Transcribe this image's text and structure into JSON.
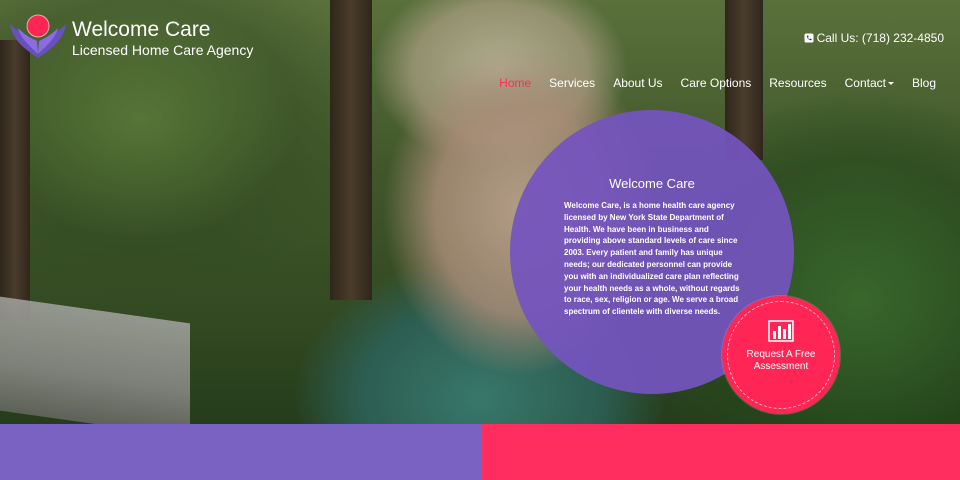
{
  "brand": {
    "title": "Welcome Care",
    "subtitle": "Licensed Home Care Agency"
  },
  "contact": {
    "phone_label": "Call Us: (718) 232-4850"
  },
  "nav": {
    "items": [
      {
        "label": "Home",
        "active": true
      },
      {
        "label": "Services"
      },
      {
        "label": "About Us"
      },
      {
        "label": "Care Options"
      },
      {
        "label": "Resources"
      },
      {
        "label": "Contact",
        "dropdown": true
      },
      {
        "label": "Blog"
      }
    ]
  },
  "info": {
    "title": "Welcome Care",
    "body": "Welcome Care, is a home health care agency licensed by New York State Department of Health. We have been in business and providing above standard levels of care since 2003. Every patient and family has unique needs; our dedicated personnel can provide you with an individualized care plan reflecting your health needs as a whole, without regards to race, sex, religion or age. We serve a broad spectrum of clientele with diverse needs."
  },
  "cta": {
    "label_line1": "Request A Free",
    "label_line2": "Assessment",
    "icon": "bar-chart-icon"
  },
  "colors": {
    "purple": "#7a62c2",
    "pink": "#ff2e5e",
    "nav_active": "#ff2d55"
  }
}
